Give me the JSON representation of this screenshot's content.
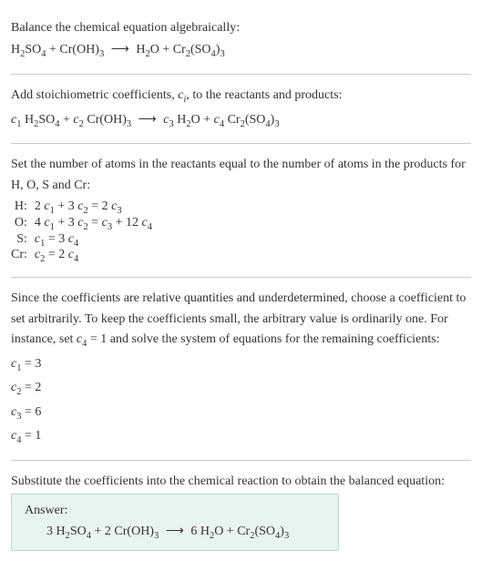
{
  "intro": {
    "title": "Balance the chemical equation algebraically:",
    "equation_html": "H<sub>2</sub>SO<sub>4</sub> + Cr(OH)<sub>3</sub> <span class='arrow'>⟶</span> H<sub>2</sub>O + Cr<sub>2</sub>(SO<sub>4</sub>)<sub>3</sub>"
  },
  "step1": {
    "text_html": "Add stoichiometric coefficients, <i>c<sub class='sub-i'>i</sub></i>, to the reactants and products:",
    "equation_html": "<i>c</i><sub>1</sub> H<sub>2</sub>SO<sub>4</sub> + <i>c</i><sub>2</sub> Cr(OH)<sub>3</sub> <span class='arrow'>⟶</span> <i>c</i><sub>3</sub> H<sub>2</sub>O + <i>c</i><sub>4</sub> Cr<sub>2</sub>(SO<sub>4</sub>)<sub>3</sub>"
  },
  "step2": {
    "text": "Set the number of atoms in the reactants equal to the number of atoms in the products for H, O, S and Cr:",
    "rows": [
      {
        "label": "H:",
        "val_html": "2 <i>c</i><sub>1</sub> + 3 <i>c</i><sub>2</sub> = 2 <i>c</i><sub>3</sub>"
      },
      {
        "label": "O:",
        "val_html": "4 <i>c</i><sub>1</sub> + 3 <i>c</i><sub>2</sub> = <i>c</i><sub>3</sub> + 12 <i>c</i><sub>4</sub>"
      },
      {
        "label": "S:",
        "val_html": "<i>c</i><sub>1</sub> = 3 <i>c</i><sub>4</sub>"
      },
      {
        "label": "Cr:",
        "val_html": "<i>c</i><sub>2</sub> = 2 <i>c</i><sub>4</sub>"
      }
    ]
  },
  "step3": {
    "text_html": "Since the coefficients are relative quantities and underdetermined, choose a coefficient to set arbitrarily. To keep the coefficients small, the arbitrary value is ordinarily one. For instance, set <i>c</i><sub>4</sub> = 1 and solve the system of equations for the remaining coefficients:",
    "solutions": [
      {
        "html": "<i>c</i><sub>1</sub> = 3"
      },
      {
        "html": "<i>c</i><sub>2</sub> = 2"
      },
      {
        "html": "<i>c</i><sub>3</sub> = 6"
      },
      {
        "html": "<i>c</i><sub>4</sub> = 1"
      }
    ]
  },
  "step4": {
    "text": "Substitute the coefficients into the chemical reaction to obtain the balanced equation:"
  },
  "answer": {
    "label": "Answer:",
    "equation_html": "3 H<sub>2</sub>SO<sub>4</sub> + 2 Cr(OH)<sub>3</sub> <span class='arrow'>⟶</span> 6 H<sub>2</sub>O + Cr<sub>2</sub>(SO<sub>4</sub>)<sub>3</sub>"
  },
  "chart_data": {
    "type": "table",
    "title": "Balanced chemical equation coefficients",
    "unbalanced_equation": "H2SO4 + Cr(OH)3 -> H2O + Cr2(SO4)3",
    "balanced_equation": "3 H2SO4 + 2 Cr(OH)3 -> 6 H2O + Cr2(SO4)3",
    "atom_balance_equations": [
      {
        "element": "H",
        "equation": "2 c1 + 3 c2 = 2 c3"
      },
      {
        "element": "O",
        "equation": "4 c1 + 3 c2 = c3 + 12 c4"
      },
      {
        "element": "S",
        "equation": "c1 = 3 c4"
      },
      {
        "element": "Cr",
        "equation": "c2 = 2 c4"
      }
    ],
    "coefficients": {
      "c1": 3,
      "c2": 2,
      "c3": 6,
      "c4": 1
    }
  }
}
